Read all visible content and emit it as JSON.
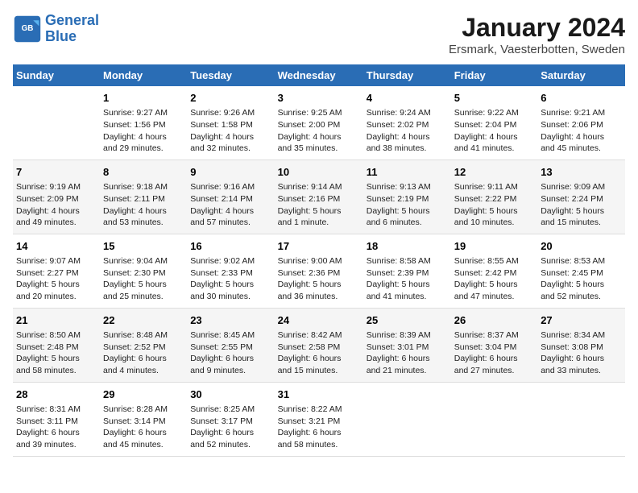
{
  "header": {
    "logo_general": "General",
    "logo_blue": "Blue",
    "title": "January 2024",
    "subtitle": "Ersmark, Vaesterbotten, Sweden"
  },
  "days_of_week": [
    "Sunday",
    "Monday",
    "Tuesday",
    "Wednesday",
    "Thursday",
    "Friday",
    "Saturday"
  ],
  "weeks": [
    [
      {
        "day": "",
        "info": ""
      },
      {
        "day": "1",
        "info": "Sunrise: 9:27 AM\nSunset: 1:56 PM\nDaylight: 4 hours\nand 29 minutes."
      },
      {
        "day": "2",
        "info": "Sunrise: 9:26 AM\nSunset: 1:58 PM\nDaylight: 4 hours\nand 32 minutes."
      },
      {
        "day": "3",
        "info": "Sunrise: 9:25 AM\nSunset: 2:00 PM\nDaylight: 4 hours\nand 35 minutes."
      },
      {
        "day": "4",
        "info": "Sunrise: 9:24 AM\nSunset: 2:02 PM\nDaylight: 4 hours\nand 38 minutes."
      },
      {
        "day": "5",
        "info": "Sunrise: 9:22 AM\nSunset: 2:04 PM\nDaylight: 4 hours\nand 41 minutes."
      },
      {
        "day": "6",
        "info": "Sunrise: 9:21 AM\nSunset: 2:06 PM\nDaylight: 4 hours\nand 45 minutes."
      }
    ],
    [
      {
        "day": "7",
        "info": "Sunrise: 9:19 AM\nSunset: 2:09 PM\nDaylight: 4 hours\nand 49 minutes."
      },
      {
        "day": "8",
        "info": "Sunrise: 9:18 AM\nSunset: 2:11 PM\nDaylight: 4 hours\nand 53 minutes."
      },
      {
        "day": "9",
        "info": "Sunrise: 9:16 AM\nSunset: 2:14 PM\nDaylight: 4 hours\nand 57 minutes."
      },
      {
        "day": "10",
        "info": "Sunrise: 9:14 AM\nSunset: 2:16 PM\nDaylight: 5 hours\nand 1 minute."
      },
      {
        "day": "11",
        "info": "Sunrise: 9:13 AM\nSunset: 2:19 PM\nDaylight: 5 hours\nand 6 minutes."
      },
      {
        "day": "12",
        "info": "Sunrise: 9:11 AM\nSunset: 2:22 PM\nDaylight: 5 hours\nand 10 minutes."
      },
      {
        "day": "13",
        "info": "Sunrise: 9:09 AM\nSunset: 2:24 PM\nDaylight: 5 hours\nand 15 minutes."
      }
    ],
    [
      {
        "day": "14",
        "info": "Sunrise: 9:07 AM\nSunset: 2:27 PM\nDaylight: 5 hours\nand 20 minutes."
      },
      {
        "day": "15",
        "info": "Sunrise: 9:04 AM\nSunset: 2:30 PM\nDaylight: 5 hours\nand 25 minutes."
      },
      {
        "day": "16",
        "info": "Sunrise: 9:02 AM\nSunset: 2:33 PM\nDaylight: 5 hours\nand 30 minutes."
      },
      {
        "day": "17",
        "info": "Sunrise: 9:00 AM\nSunset: 2:36 PM\nDaylight: 5 hours\nand 36 minutes."
      },
      {
        "day": "18",
        "info": "Sunrise: 8:58 AM\nSunset: 2:39 PM\nDaylight: 5 hours\nand 41 minutes."
      },
      {
        "day": "19",
        "info": "Sunrise: 8:55 AM\nSunset: 2:42 PM\nDaylight: 5 hours\nand 47 minutes."
      },
      {
        "day": "20",
        "info": "Sunrise: 8:53 AM\nSunset: 2:45 PM\nDaylight: 5 hours\nand 52 minutes."
      }
    ],
    [
      {
        "day": "21",
        "info": "Sunrise: 8:50 AM\nSunset: 2:48 PM\nDaylight: 5 hours\nand 58 minutes."
      },
      {
        "day": "22",
        "info": "Sunrise: 8:48 AM\nSunset: 2:52 PM\nDaylight: 6 hours\nand 4 minutes."
      },
      {
        "day": "23",
        "info": "Sunrise: 8:45 AM\nSunset: 2:55 PM\nDaylight: 6 hours\nand 9 minutes."
      },
      {
        "day": "24",
        "info": "Sunrise: 8:42 AM\nSunset: 2:58 PM\nDaylight: 6 hours\nand 15 minutes."
      },
      {
        "day": "25",
        "info": "Sunrise: 8:39 AM\nSunset: 3:01 PM\nDaylight: 6 hours\nand 21 minutes."
      },
      {
        "day": "26",
        "info": "Sunrise: 8:37 AM\nSunset: 3:04 PM\nDaylight: 6 hours\nand 27 minutes."
      },
      {
        "day": "27",
        "info": "Sunrise: 8:34 AM\nSunset: 3:08 PM\nDaylight: 6 hours\nand 33 minutes."
      }
    ],
    [
      {
        "day": "28",
        "info": "Sunrise: 8:31 AM\nSunset: 3:11 PM\nDaylight: 6 hours\nand 39 minutes."
      },
      {
        "day": "29",
        "info": "Sunrise: 8:28 AM\nSunset: 3:14 PM\nDaylight: 6 hours\nand 45 minutes."
      },
      {
        "day": "30",
        "info": "Sunrise: 8:25 AM\nSunset: 3:17 PM\nDaylight: 6 hours\nand 52 minutes."
      },
      {
        "day": "31",
        "info": "Sunrise: 8:22 AM\nSunset: 3:21 PM\nDaylight: 6 hours\nand 58 minutes."
      },
      {
        "day": "",
        "info": ""
      },
      {
        "day": "",
        "info": ""
      },
      {
        "day": "",
        "info": ""
      }
    ]
  ]
}
